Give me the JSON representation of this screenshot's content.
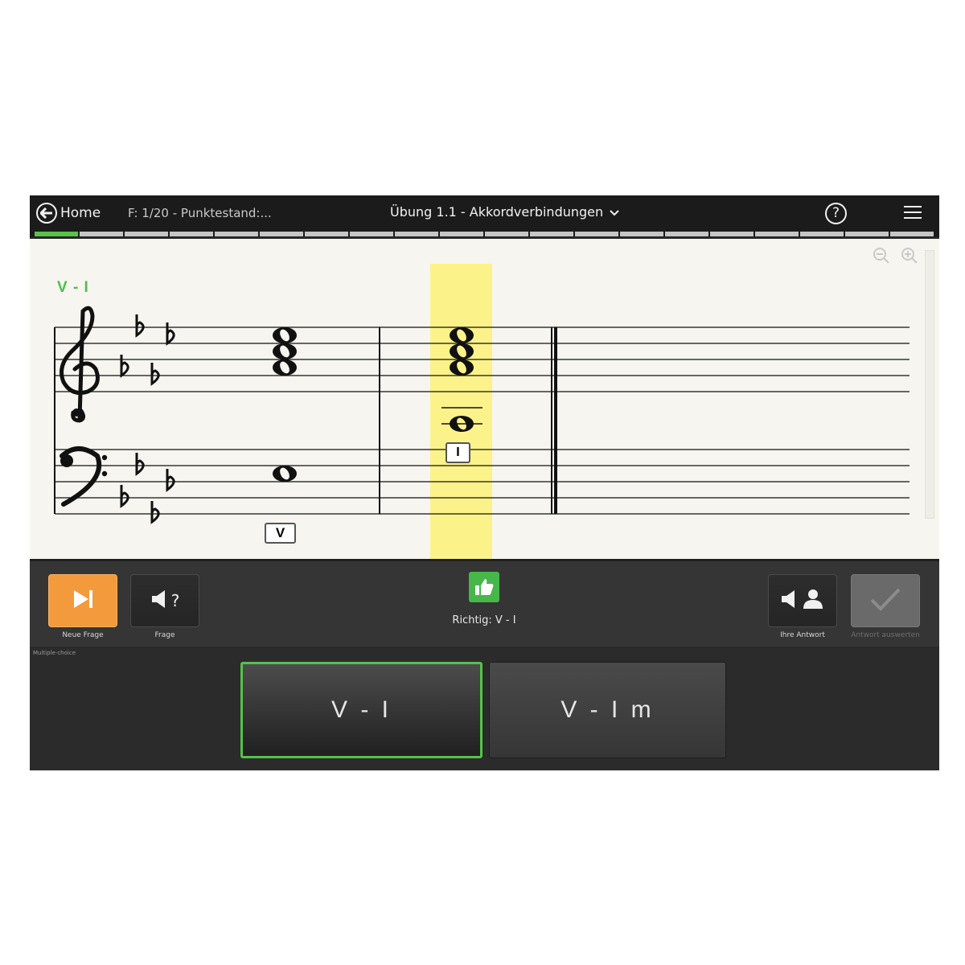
{
  "topbar": {
    "home_label": "Home",
    "progress_label": "F: 1/20 - Punktestand:...",
    "title": "Übung 1.1 - Akkordverbindungen",
    "help_symbol": "?",
    "progress": {
      "current": 1,
      "total": 20
    }
  },
  "notation": {
    "chord_label": "V - I",
    "key_signature": "4 flats",
    "degree_first": "V",
    "degree_second": "I",
    "highlight_color": "#fbf38a"
  },
  "controls": {
    "new_question_label": "Neue Frage",
    "question_label": "Frage",
    "question_symbol": "?",
    "feedback_text": "Richtig: V - I",
    "your_answer_label": "Ihre Antwort",
    "evaluate_label": "Antwort auswerten"
  },
  "answers": {
    "section_label": "Multiple-choice",
    "options": [
      {
        "label": "V - I",
        "selected": true
      },
      {
        "label": "V - I m",
        "selected": false
      }
    ]
  },
  "colors": {
    "accent_orange": "#f39a3c",
    "correct_green": "#46b749",
    "progress_green": "#5bc04c"
  }
}
